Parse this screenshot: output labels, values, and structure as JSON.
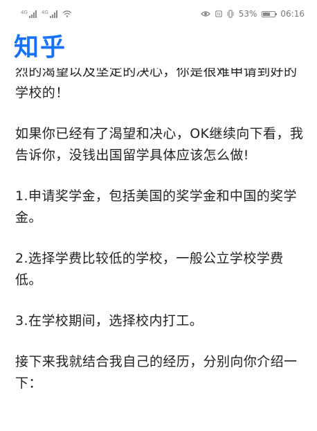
{
  "status_bar": {
    "time": "06:16",
    "battery": "53%",
    "signal_1_label": "4G",
    "signal_2_label": "4G",
    "icons": [
      "signal-icon",
      "signal-icon",
      "wifi-icon",
      "eye-icon",
      "nfc-icon",
      "vibrate-icon",
      "battery-icon"
    ]
  },
  "app": {
    "logo": "知乎",
    "brand_color": "#1772f6"
  },
  "article": {
    "paragraphs": [
      "烈的渴望以及坚定的决心，你是很难申请到好的学校的！",
      "如果你已经有了渴望和决心，OK继续向下看，我告诉你，没钱出国留学具体应该怎么做!",
      "1.申请奖学金，包括美国的奖学金和中国的奖学金。",
      "2.选择学费比较低的学校，一般公立学校学费低。",
      "3.在学校期间，选择校内打工。",
      "接下来我就结合我自己的经历，分别向你介绍一下："
    ]
  }
}
